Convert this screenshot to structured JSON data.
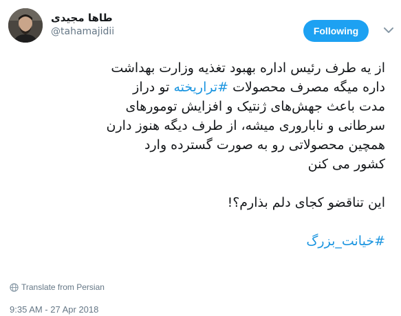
{
  "user": {
    "name": "طاها مجیدی",
    "handle": "@tahamajidii"
  },
  "follow_button": {
    "label": "Following",
    "color": "#1da1f2"
  },
  "caret_icon": "chevron-down-icon",
  "tweet": {
    "line1": "از یه طرف رئیس اداره بهبود تغذیه وزارت بهداشت",
    "line2_before": "داره میگه مصرف محصولات ",
    "line2_hashtag": "#تراریخته",
    "line2_after": " تو دراز",
    "line3": "مدت باعث جهش‌های ژنتیک و افزایش تومورهای",
    "line4": "سرطانی و ناباروری میشه، از طرف دیگه هنوز دارن",
    "line5": "همچین محصولاتی رو به صورت گسترده وارد",
    "line6": "کشور می کنن",
    "line7": "این تناقضو کجای دلم بذارم؟!",
    "hashtag2": "#خیانت_بزرگ",
    "hashtag_color": "#1b95e0"
  },
  "translate": {
    "label": "Translate from Persian",
    "icon": "globe-icon"
  },
  "timestamp": "9:35 AM - 27 Apr 2018"
}
